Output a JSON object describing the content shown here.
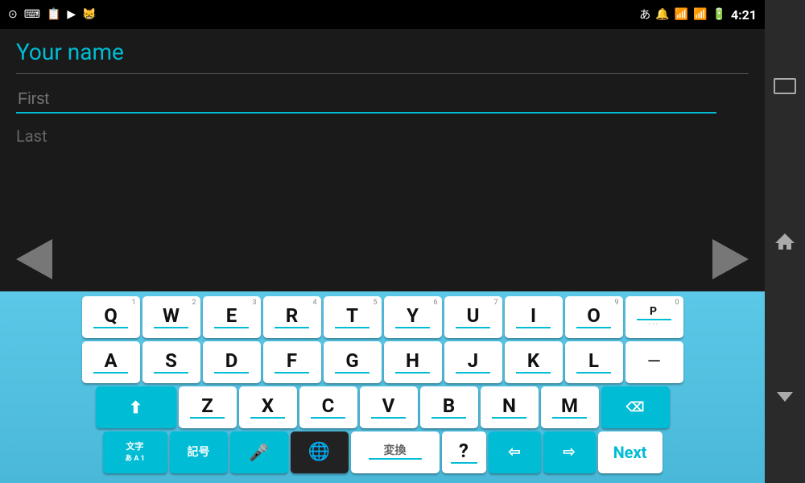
{
  "statusBar": {
    "leftIcons": [
      "⊙",
      "⌨",
      "📋",
      "▶",
      "😸"
    ],
    "rightText": "あ",
    "time": "4:21"
  },
  "page": {
    "title": "Your name",
    "firstPlaceholder": "First",
    "lastPlaceholder": "Last"
  },
  "keyboard": {
    "rows": [
      [
        {
          "label": "Q",
          "num": "1"
        },
        {
          "label": "W",
          "num": "2"
        },
        {
          "label": "E",
          "num": "3"
        },
        {
          "label": "R",
          "num": "4"
        },
        {
          "label": "T",
          "num": "5"
        },
        {
          "label": "Y",
          "num": "6"
        },
        {
          "label": "U",
          "num": "7"
        },
        {
          "label": "I",
          "num": ""
        },
        {
          "label": "O",
          "num": "9"
        },
        {
          "label": "P",
          "num": "0"
        }
      ],
      [
        {
          "label": "A",
          "num": ""
        },
        {
          "label": "S",
          "num": ""
        },
        {
          "label": "D",
          "num": ""
        },
        {
          "label": "F",
          "num": ""
        },
        {
          "label": "G",
          "num": ""
        },
        {
          "label": "H",
          "num": ""
        },
        {
          "label": "J",
          "num": ""
        },
        {
          "label": "K",
          "num": ""
        },
        {
          "label": "L",
          "num": ""
        },
        {
          "label": "—",
          "num": "",
          "special": "dash"
        }
      ],
      [
        {
          "label": "↑",
          "num": "",
          "special": "shift"
        },
        {
          "label": "Z",
          "num": ""
        },
        {
          "label": "X",
          "num": ""
        },
        {
          "label": "C",
          "num": ""
        },
        {
          "label": "V",
          "num": ""
        },
        {
          "label": "B",
          "num": ""
        },
        {
          "label": "N",
          "num": ""
        },
        {
          "label": "M",
          "num": ""
        },
        {
          "label": "⌫",
          "num": "",
          "special": "delete"
        }
      ]
    ],
    "bottomRow": [
      {
        "label": "文字\nあ A 1",
        "special": "moji"
      },
      {
        "label": "記号",
        "special": "kigo"
      },
      {
        "label": "🎤",
        "special": "mic"
      },
      {
        "label": "🌐",
        "special": "globe"
      },
      {
        "label": "変換",
        "special": "space"
      },
      {
        "label": "?",
        "special": "question"
      },
      {
        "label": "←",
        "special": "arrow-left"
      },
      {
        "label": "→",
        "special": "arrow-right"
      },
      {
        "label": "Next",
        "special": "next"
      }
    ]
  },
  "sideNav": {
    "buttons": [
      "rect",
      "home",
      "chevron"
    ]
  }
}
